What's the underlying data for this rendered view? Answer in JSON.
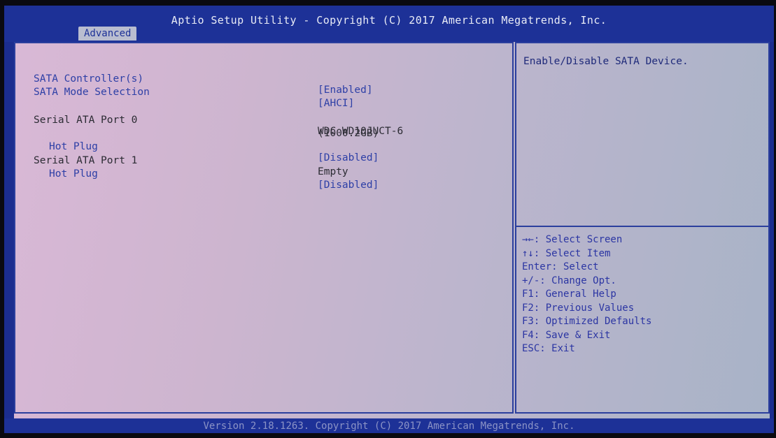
{
  "header": {
    "title": "Aptio Setup Utility - Copyright (C) 2017 American Megatrends, Inc.",
    "active_tab": "Advanced"
  },
  "settings": [
    {
      "label": "SATA Controller(s)",
      "value": "[Enabled]"
    },
    {
      "label": "SATA Mode Selection",
      "value": "[AHCI]"
    },
    {
      "label": "Serial ATA Port 0",
      "value": "WDC WD10JUCT-6",
      "value2": "(1000.2GB)"
    },
    {
      "label": "Hot Plug",
      "value": "[Disabled]"
    },
    {
      "label": "Serial ATA Port 1",
      "value": "Empty"
    },
    {
      "label": "Hot Plug",
      "value": "[Disabled]"
    }
  ],
  "help": {
    "description": "Enable/Disable SATA Device.",
    "keys": [
      "→←: Select Screen",
      "↑↓: Select Item",
      "Enter: Select",
      "+/-: Change Opt.",
      "F1: General Help",
      "F2: Previous Values",
      "F3: Optimized Defaults",
      "F4: Save & Exit",
      "ESC: Exit"
    ]
  },
  "footer": {
    "text": "Version 2.18.1263. Copyright (C) 2017 American Megatrends, Inc."
  }
}
